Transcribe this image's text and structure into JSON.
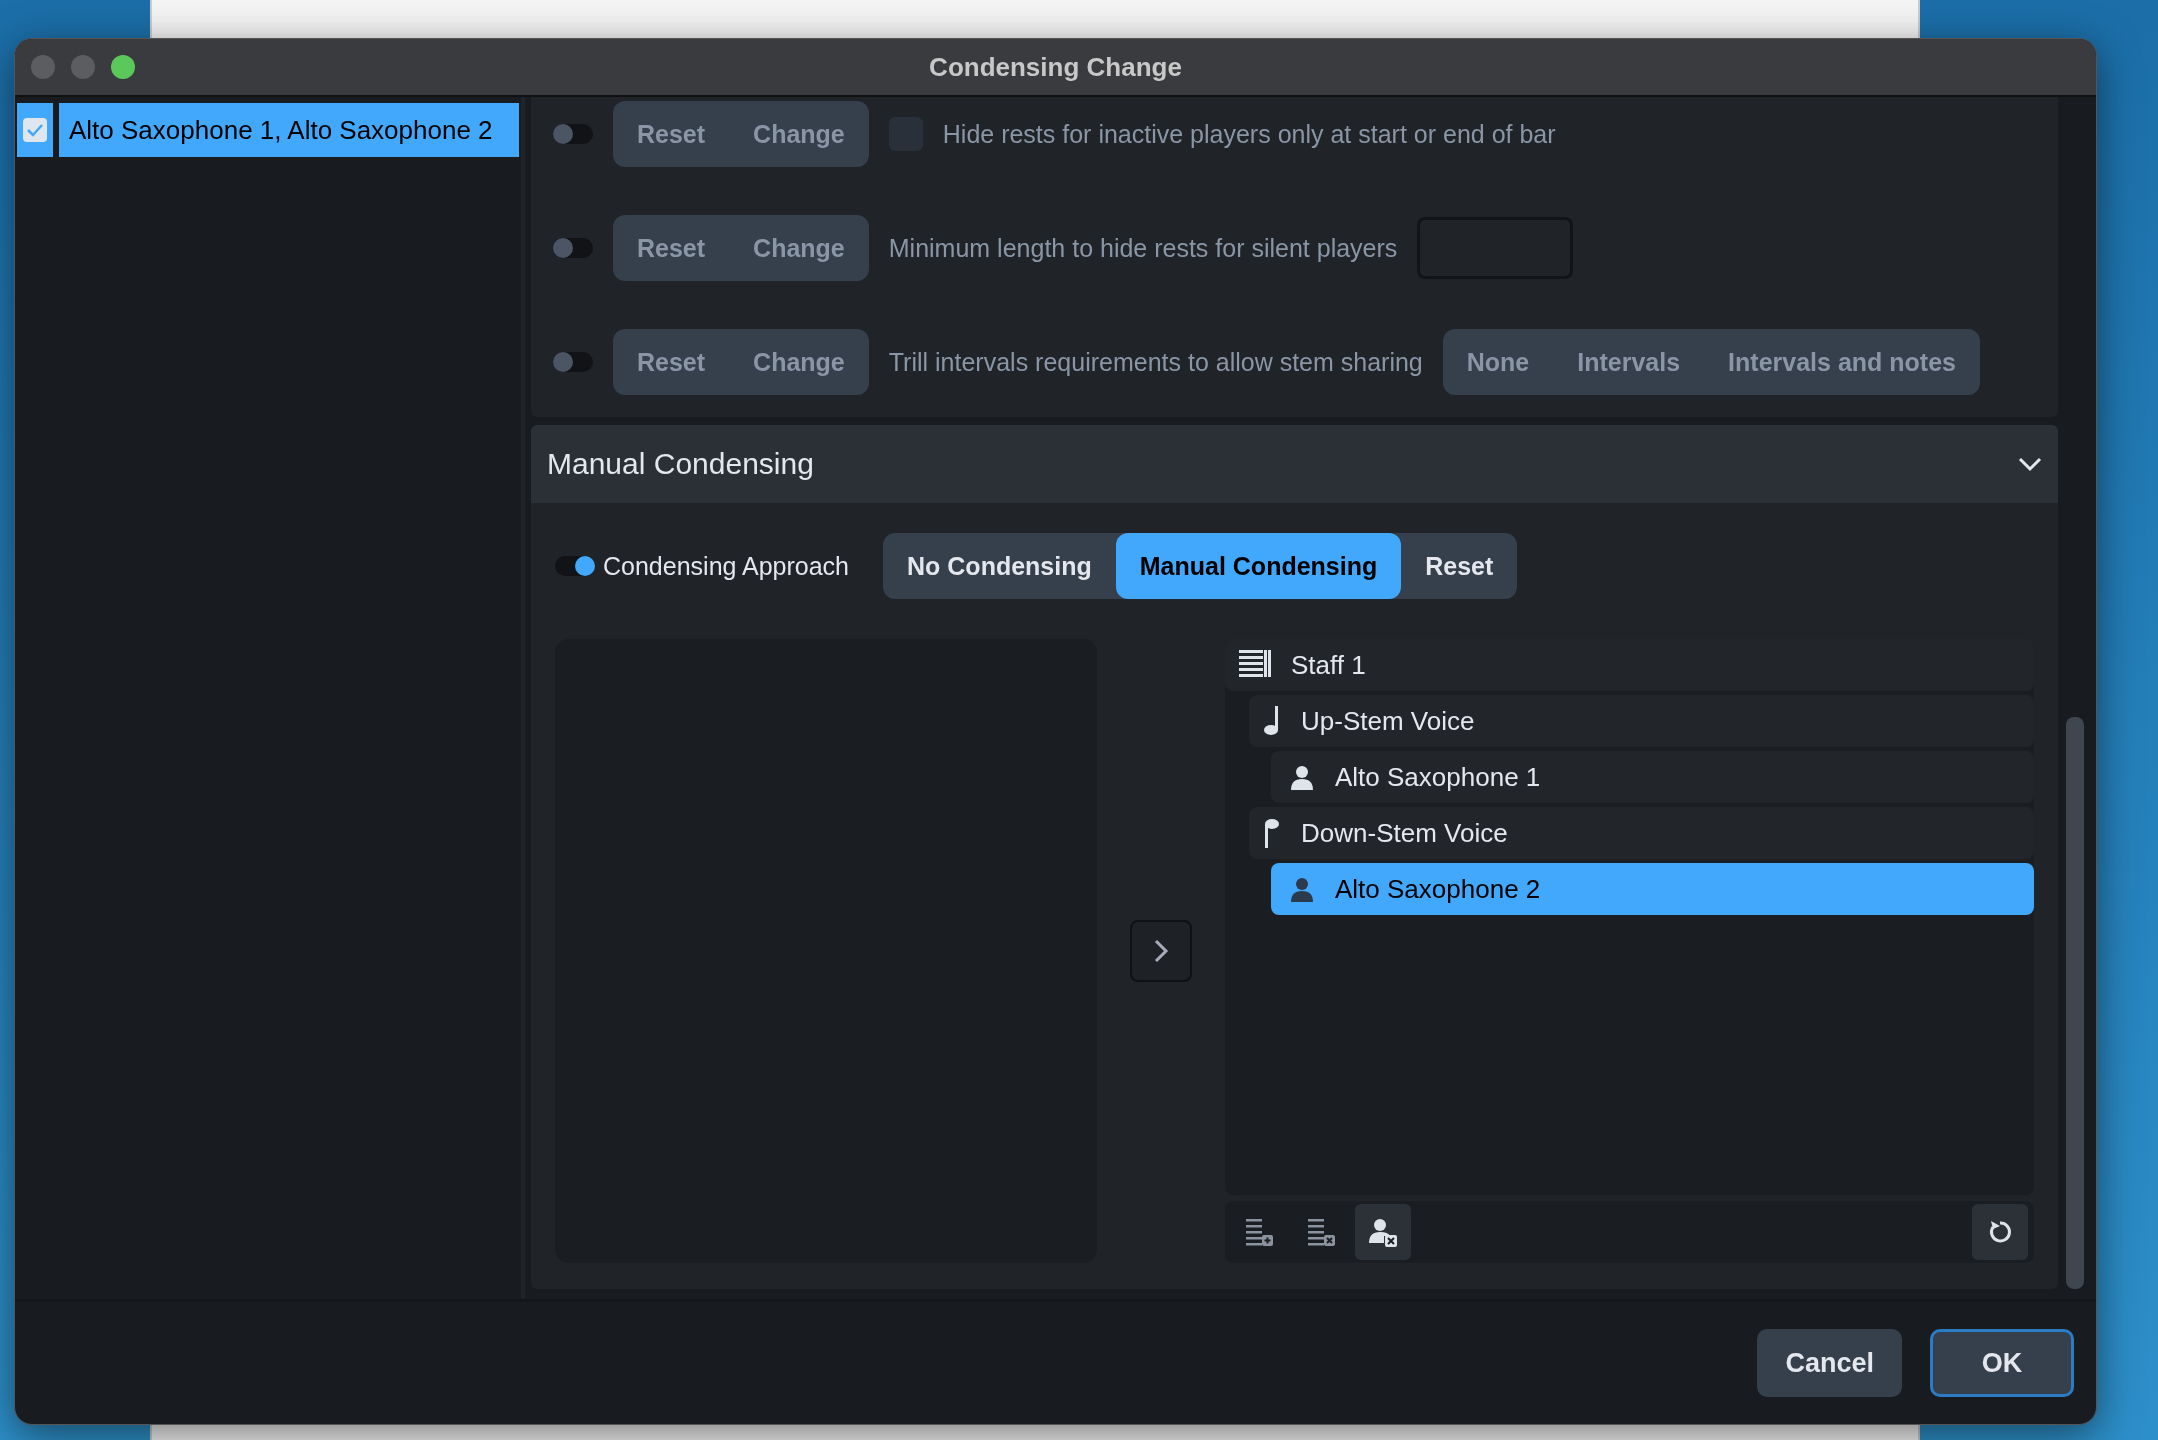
{
  "window": {
    "title": "Condensing Change"
  },
  "sidebar": {
    "items": [
      {
        "label": "Alto Saxophone 1, Alto Saxophone 2",
        "checked": true,
        "selected": true
      }
    ]
  },
  "options": [
    {
      "kind": "checkbox",
      "on": false,
      "buttons": [
        "Reset",
        "Change"
      ],
      "label": "Hide rests for inactive players only at start or end of bar",
      "checked": false
    },
    {
      "kind": "field",
      "on": false,
      "buttons": [
        "Reset",
        "Change"
      ],
      "label": "Minimum length to hide rests for silent players"
    },
    {
      "kind": "choice",
      "on": false,
      "buttons": [
        "Reset",
        "Change"
      ],
      "label": "Trill intervals requirements to allow stem sharing",
      "choices": [
        {
          "label": "None",
          "selected": false
        },
        {
          "label": "Intervals",
          "selected": false
        },
        {
          "label": "Intervals and notes",
          "selected": false
        }
      ]
    }
  ],
  "manual_condensing": {
    "title": "Manual Condensing",
    "expanded": true,
    "approach": {
      "label": "Condensing Approach",
      "on": true,
      "choices": [
        {
          "label": "No Condensing",
          "selected": false
        },
        {
          "label": "Manual Condensing",
          "selected": true
        },
        {
          "label": "Reset",
          "selected": false
        }
      ]
    },
    "tree": [
      {
        "kind": "staff",
        "label": "Staff 1",
        "selected": false,
        "children": [
          {
            "kind": "up-stem",
            "label": "Up-Stem Voice",
            "selected": false,
            "children": [
              {
                "kind": "player",
                "label": "Alto Saxophone 1",
                "selected": false
              }
            ]
          },
          {
            "kind": "down-stem",
            "label": "Down-Stem Voice",
            "selected": false,
            "children": [
              {
                "kind": "player",
                "label": "Alto Saxophone 2",
                "selected": true
              }
            ]
          }
        ]
      }
    ]
  },
  "footer": {
    "buttons": [
      {
        "label": "Cancel",
        "kind": "secondary"
      },
      {
        "label": "OK",
        "kind": "default"
      }
    ]
  }
}
